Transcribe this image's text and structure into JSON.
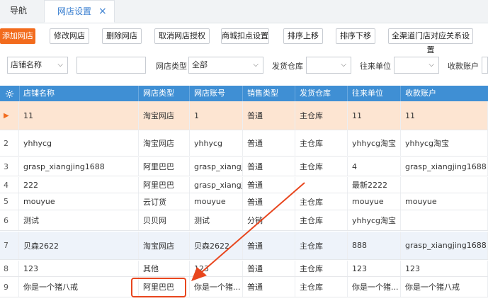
{
  "tabs": {
    "nav_label": "导航",
    "active_label": "网店设置",
    "close_glyph": "×"
  },
  "toolbar": {
    "buttons": [
      "添加网店",
      "修改网店",
      "删除网店",
      "取消网店授权",
      "商城扣点设置",
      "排序上移",
      "排序下移",
      "全渠道门店对应关系设置"
    ]
  },
  "filters": {
    "field_select": "店铺名称",
    "search_value": "",
    "store_type_label": "网店类型",
    "store_type_value": "全部",
    "warehouse_label": "发货仓库",
    "warehouse_value": "",
    "partner_label": "往来单位",
    "partner_value": "",
    "account_label": "收款账户"
  },
  "table": {
    "headers": [
      "店铺名称",
      "网店类型",
      "网店账号",
      "销售类型",
      "发货仓库",
      "往来单位",
      "收款账户"
    ],
    "rows": [
      {
        "idx": "▶",
        "name": "11",
        "type": "淘宝网店",
        "account": "1",
        "sale": "普通",
        "warehouse": "主仓库",
        "partner": "11",
        "pay": "11"
      },
      {
        "idx": "2",
        "name": "yhhycg",
        "type": "淘宝网店",
        "account": "yhhycg",
        "sale": "普通",
        "warehouse": "主仓库",
        "partner": "yhhycg淘宝",
        "pay": "yhhycg淘宝"
      },
      {
        "idx": "3",
        "name": "grasp_xiangjing1688",
        "type": "阿里巴巴",
        "account": "grasp_xiangj...",
        "sale": "普通",
        "warehouse": "主仓库",
        "partner": "4",
        "pay": "grasp_xiangjing1688"
      },
      {
        "idx": "4",
        "name": "222",
        "type": "阿里巴巴",
        "account": "grasp_xiangj...",
        "sale": "普通",
        "warehouse": "",
        "partner": "最新2222",
        "pay": ""
      },
      {
        "idx": "5",
        "name": "mouyue",
        "type": "云订货",
        "account": "mouyue",
        "sale": "普通",
        "warehouse": "主仓库",
        "partner": "mouyue",
        "pay": "mouyue"
      },
      {
        "idx": "6",
        "name": "测试",
        "type": "贝贝网",
        "account": "测试",
        "sale": "分销",
        "warehouse": "主仓库",
        "partner": "yhhycg淘宝",
        "pay": ""
      },
      {
        "idx": "7",
        "name": "贝森2622",
        "type": "淘宝网店",
        "account": "贝森2622",
        "sale": "普通",
        "warehouse": "主仓库",
        "partner": "888",
        "pay": "grasp_xiangjing1688"
      },
      {
        "idx": "8",
        "name": "123",
        "type": "其他",
        "account": "123",
        "sale": "普通",
        "warehouse": "主仓库",
        "partner": "123",
        "pay": "123"
      },
      {
        "idx": "9",
        "name": "你是一个猪八戒",
        "type": "阿里巴巴",
        "account": "你是一个猪...",
        "sale": "普通",
        "warehouse": "主仓库",
        "partner": "你是一个猪...",
        "pay": "你是一个猪八戒"
      }
    ]
  },
  "colors": {
    "accent": "#f26b1d",
    "header_blue": "#3f8fd4",
    "callout_red": "#e8461e"
  },
  "icons": {
    "header_settings": "gear-icon",
    "select_chevron": "chevron-down-icon",
    "current_row": "play-marker-icon"
  }
}
